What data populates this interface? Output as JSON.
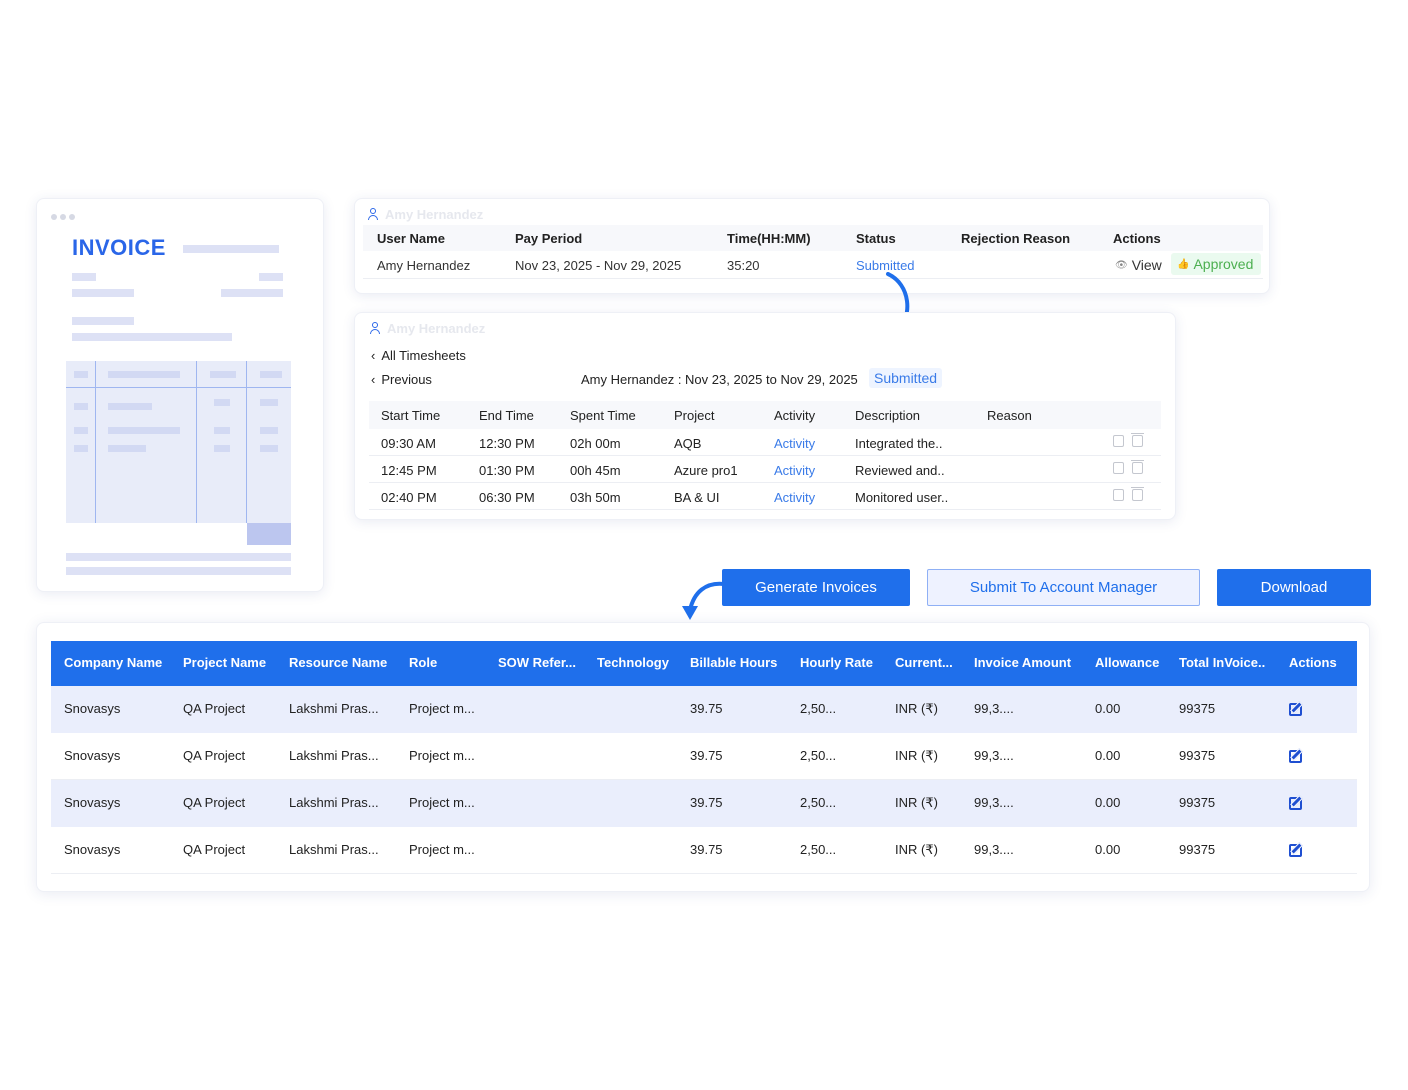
{
  "invoice_preview": {
    "title": "INVOICE"
  },
  "approval_panel": {
    "user_name": "Amy Hernandez",
    "columns": [
      "User Name",
      "Pay Period",
      "Time(HH:MM)",
      "Status",
      "Rejection Reason",
      "Actions"
    ],
    "row": {
      "user_name": "Amy Hernandez",
      "pay_period": "Nov 23, 2025  -  Nov 29, 2025",
      "time": "35:20",
      "status": "Submitted",
      "rejection_reason": "",
      "view_label": "View",
      "approved_label": "Approved"
    },
    "icons": {
      "user": "person-icon",
      "view": "eye-icon",
      "approved": "thumbs-up-icon"
    }
  },
  "timesheet_panel": {
    "user_name": "Amy Hernandez",
    "all_timesheets_label": "All Timesheets",
    "previous_label": "Previous",
    "summary": "Amy Hernandez : Nov 23, 2025 to Nov 29, 2025",
    "status_badge": "Submitted",
    "columns": [
      "Start Time",
      "End Time",
      "Spent Time",
      "Project",
      "Activity",
      "Description",
      "Reason"
    ],
    "rows": [
      {
        "start": "09:30 AM",
        "end": "12:30 PM",
        "spent": "02h 00m",
        "project": "AQB",
        "activity": "Activity",
        "description": "Integrated the..",
        "reason": ""
      },
      {
        "start": "12:45 PM",
        "end": "01:30 PM",
        "spent": "00h 45m",
        "project": "Azure pro1",
        "activity": "Activity",
        "description": "Reviewed and..",
        "reason": ""
      },
      {
        "start": "02:40 PM",
        "end": "06:30 PM",
        "spent": "03h 50m",
        "project": "BA & UI",
        "activity": "Activity",
        "description": "Monitored user..",
        "reason": ""
      }
    ]
  },
  "actions": {
    "generate_invoices": "Generate Invoices",
    "submit_to_account_manager": "Submit To Account Manager",
    "download": "Download"
  },
  "invoice_table": {
    "columns": [
      "Company Name",
      "Project Name",
      "Resource Name",
      "Role",
      "SOW Refer...",
      "Technology",
      "Billable Hours",
      "Hourly Rate",
      "Current...",
      "Invoice Amount",
      "Allowance",
      "Total InVoice..",
      "Actions"
    ],
    "rows": [
      {
        "company": "Snovasys",
        "project": "QA Project",
        "resource": "Lakshmi Pras...",
        "role": "Project m...",
        "sow": "",
        "technology": "",
        "billable_hours": "39.75",
        "hourly_rate": "2,50...",
        "currency": "INR (₹)",
        "invoice_amount": "99,3....",
        "allowance": "0.00",
        "total_invoice": "99375"
      },
      {
        "company": "Snovasys",
        "project": "QA Project",
        "resource": "Lakshmi Pras...",
        "role": "Project m...",
        "sow": "",
        "technology": "",
        "billable_hours": "39.75",
        "hourly_rate": "2,50...",
        "currency": "INR (₹)",
        "invoice_amount": "99,3....",
        "allowance": "0.00",
        "total_invoice": "99375"
      },
      {
        "company": "Snovasys",
        "project": "QA Project",
        "resource": "Lakshmi Pras...",
        "role": "Project m...",
        "sow": "",
        "technology": "",
        "billable_hours": "39.75",
        "hourly_rate": "2,50...",
        "currency": "INR (₹)",
        "invoice_amount": "99,3....",
        "allowance": "0.00",
        "total_invoice": "99375"
      },
      {
        "company": "Snovasys",
        "project": "QA Project",
        "resource": "Lakshmi Pras...",
        "role": "Project m...",
        "sow": "",
        "technology": "",
        "billable_hours": "39.75",
        "hourly_rate": "2,50...",
        "currency": "INR (₹)",
        "invoice_amount": "99,3....",
        "allowance": "0.00",
        "total_invoice": "99375"
      }
    ]
  },
  "colors": {
    "primary": "#1f6feb",
    "link": "#3a7be8",
    "approved": "#4caf50",
    "row_shade": "#eaeefc"
  }
}
